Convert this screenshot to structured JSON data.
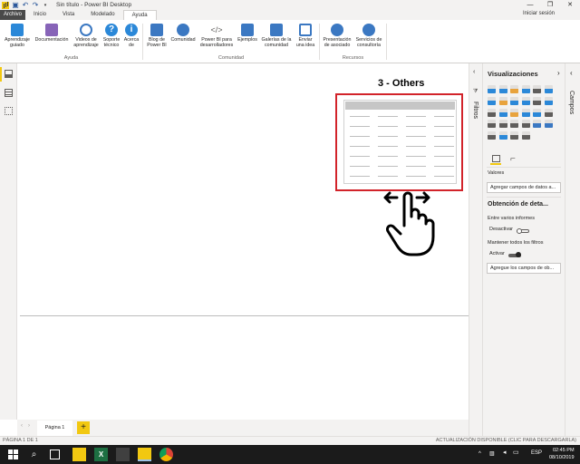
{
  "window": {
    "title": "Sin título - Power BI Desktop",
    "minimize": "—",
    "maximize": "❐",
    "close": "✕"
  },
  "tabs": [
    {
      "label": "Archivo"
    },
    {
      "label": "Inicio"
    },
    {
      "label": "Vista"
    },
    {
      "label": "Modelado"
    },
    {
      "label": "Ayuda"
    }
  ],
  "signin": "Iniciar sesión",
  "ribbon": {
    "buttons": [
      {
        "l1": "Aprendizaje",
        "l2": "guiado",
        "icon": "learn-icon",
        "color": "#2b88d8"
      },
      {
        "l1": "Documentación",
        "l2": "",
        "icon": "book-icon",
        "color": "#8764b8"
      },
      {
        "l1": "Videos de",
        "l2": "aprendizaje",
        "icon": "globe-icon",
        "color": "#3b78c2"
      },
      {
        "l1": "Soporte",
        "l2": "técnico",
        "icon": "help-icon",
        "color": "#2b88d8"
      },
      {
        "l1": "Acerca",
        "l2": "de",
        "icon": "info-icon",
        "color": "#2b88d8"
      },
      {
        "l1": "Blog de",
        "l2": "Power BI",
        "icon": "blog-icon",
        "color": "#3b78c2"
      },
      {
        "l1": "Comunidad",
        "l2": "",
        "icon": "community-icon",
        "color": "#3b78c2"
      },
      {
        "l1": "Power BI para",
        "l2": "desarrolladores",
        "icon": "code-icon",
        "color": "#605e5c"
      },
      {
        "l1": "Ejemplos",
        "l2": "",
        "icon": "examples-icon",
        "color": "#3b78c2"
      },
      {
        "l1": "Galerías de la",
        "l2": "comunidad",
        "icon": "gallery-icon",
        "color": "#3b78c2"
      },
      {
        "l1": "Enviar",
        "l2": "una idea",
        "icon": "idea-icon",
        "color": "#3b78c2"
      },
      {
        "l1": "Presentación",
        "l2": "de asociado",
        "icon": "partner-icon",
        "color": "#3b78c2"
      },
      {
        "l1": "Servicios de",
        "l2": "consultoría",
        "icon": "consulting-icon",
        "color": "#3b78c2"
      }
    ],
    "groups": [
      "Ayuda",
      "Comunidad",
      "Recursos"
    ]
  },
  "annotation": {
    "title": "3 - Others",
    "box_color": "#d2232a"
  },
  "pages": {
    "tab1": "Página 1",
    "add": "+"
  },
  "status": {
    "page": "PÁGINA 1 DE 1",
    "update": "ACTUALIZACIÓN DISPONIBLE (CLIC PARA DESCARGARLA)"
  },
  "panes": {
    "filters": "Filtros",
    "fields": "Campos",
    "viz_title": "Visualizaciones",
    "values_label": "Valores",
    "add_fields": "Agregar campos de datos a...",
    "drillthrough": "Obtención de deta...",
    "cross_report": "Entre varios informes",
    "cross_state": "Desactivar",
    "keep_filters": "Mantener todos los filtros",
    "keep_state": "Activar",
    "add_drill": "Agregue los campos de ob..."
  },
  "taskbar": {
    "time": "02:45 PM",
    "date": "08/10/2019",
    "lang": "ESP"
  },
  "colors": {
    "accent": "#f2c811",
    "pane_bg": "#f3f2f1",
    "taskbar": "#1b1b1b"
  }
}
